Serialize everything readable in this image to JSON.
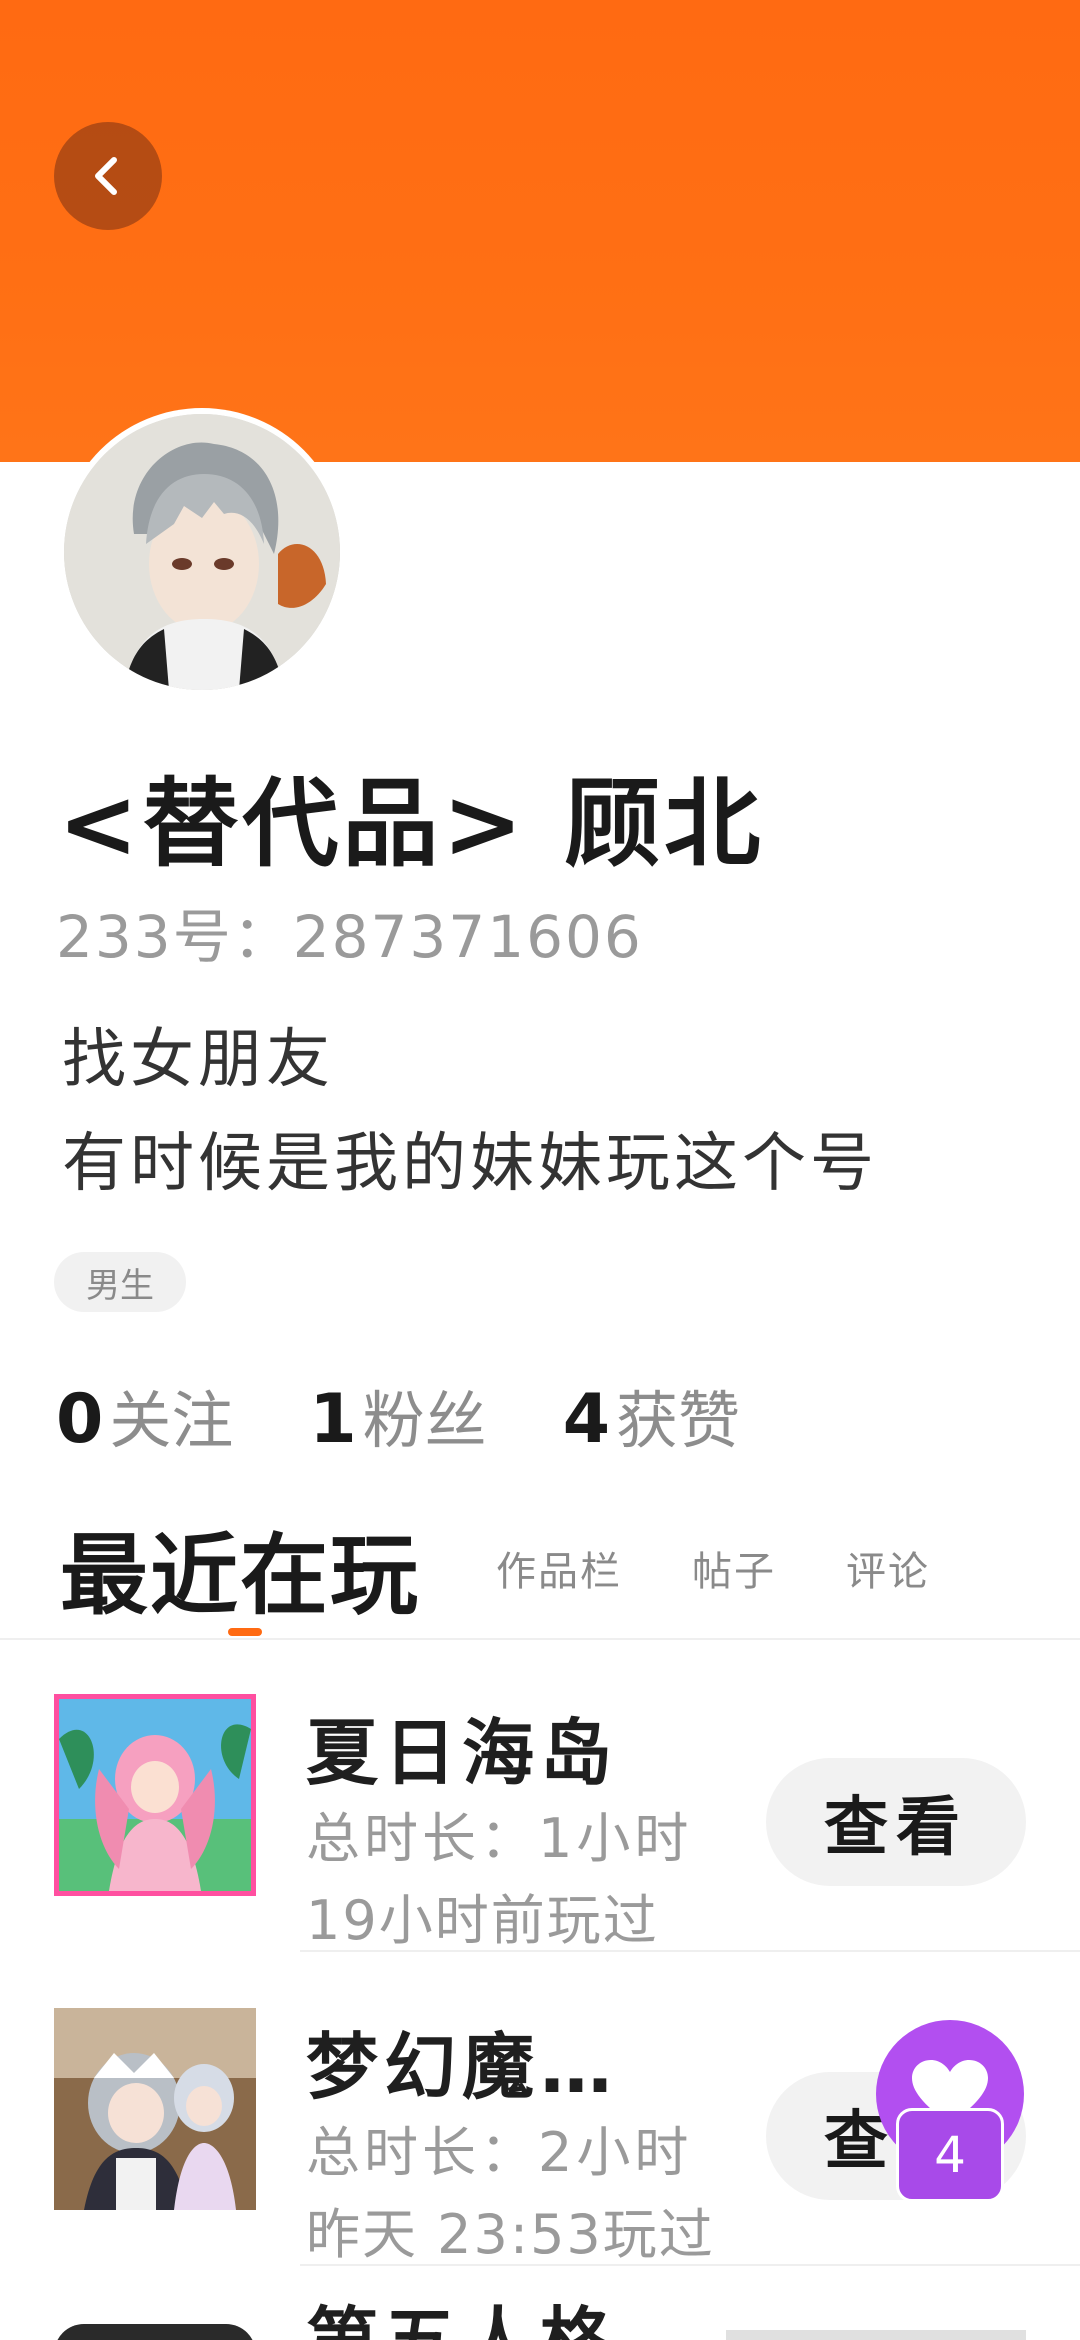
{
  "profile": {
    "name": "<替代品>  顾北",
    "uid": "233号：287371606",
    "bio_lines": [
      "找女朋友",
      "有时候是我的妹妹玩这个号"
    ],
    "gender_tag": "男生",
    "stats": [
      {
        "value": "0",
        "label": "关注"
      },
      {
        "value": "1",
        "label": "粉丝"
      },
      {
        "value": "4",
        "label": "获赞"
      }
    ]
  },
  "tabs": {
    "active": "最近在玩",
    "items": [
      "作品栏",
      "帖子",
      "评论"
    ]
  },
  "games": [
    {
      "title": "夏日海岛",
      "duration": "总时长：1小时",
      "last_played": "19小时前玩过",
      "action": "查看"
    },
    {
      "title": "梦幻魔…",
      "duration": "总时长：2小时",
      "last_played": "昨天 23:53玩过",
      "action": "查看"
    },
    {
      "title": "第五人格",
      "duration": "",
      "last_played": "",
      "action": ""
    }
  ],
  "floating": {
    "like_count": "4"
  },
  "colors": {
    "banner": "#ff6a12",
    "accent": "#ff6a12",
    "floating_button": "#b24ff0"
  },
  "icons": {
    "back": "chevron-left-icon",
    "like": "heart-icon"
  }
}
